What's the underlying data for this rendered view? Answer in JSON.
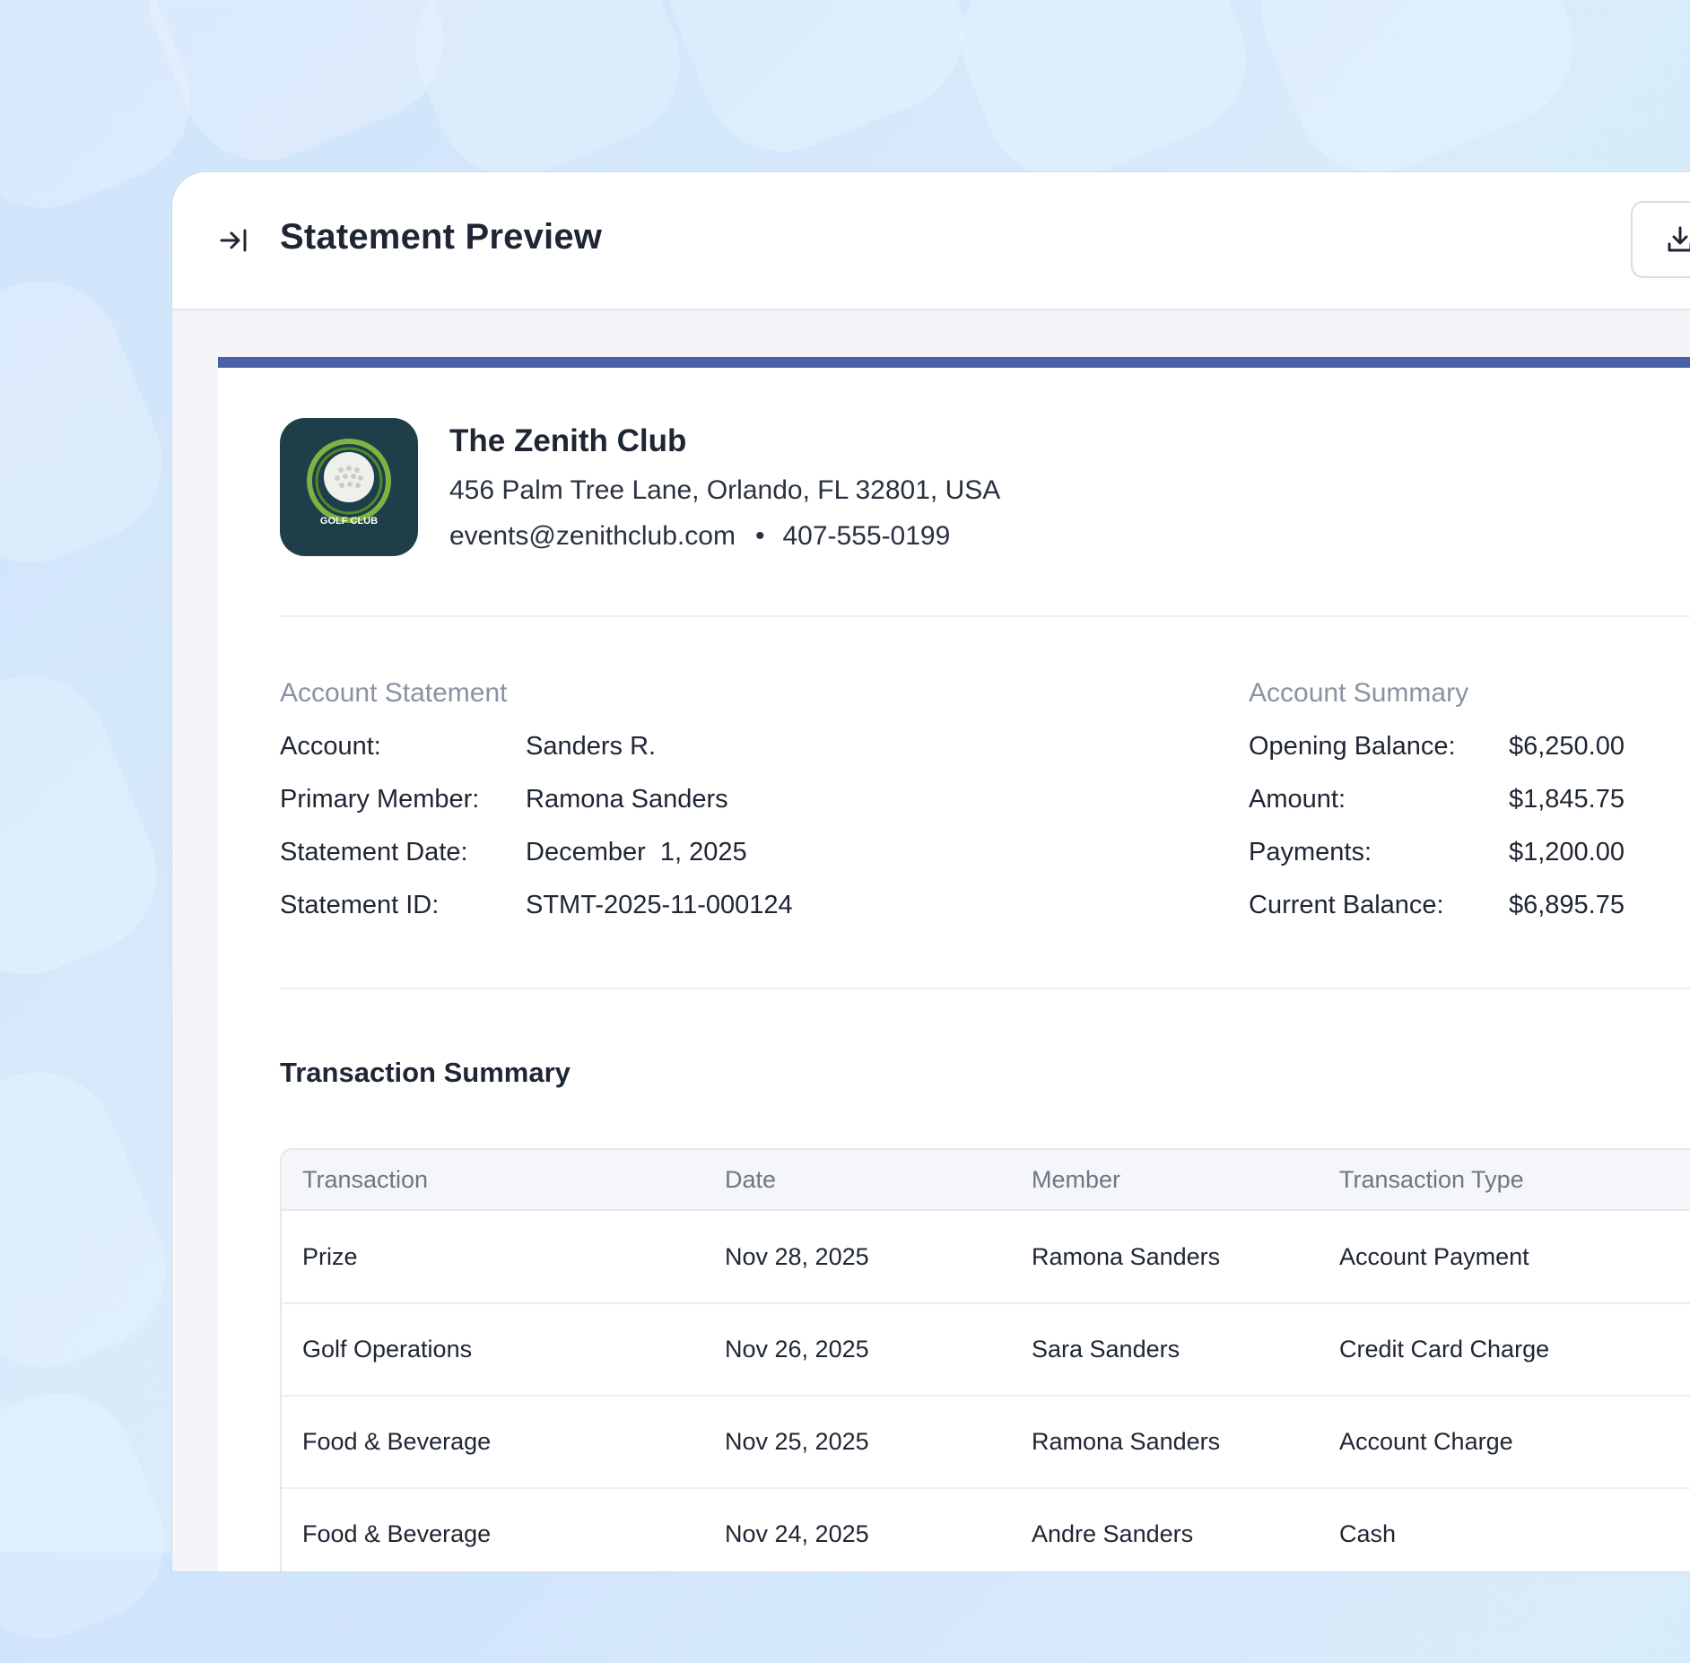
{
  "header": {
    "title": "Statement Preview",
    "collapse_icon": "collapse-panel-icon",
    "download_icon": "download-icon"
  },
  "club": {
    "name": "The Zenith Club",
    "address": "456 Palm Tree Lane, Orlando, FL 32801, USA",
    "email": "events@zenithclub.com",
    "separator": "•",
    "phone": "407-555-0199",
    "logo_text": "GOLF CLUB"
  },
  "account_statement": {
    "heading": "Account Statement",
    "rows": [
      {
        "label": "Account:",
        "value": "Sanders R."
      },
      {
        "label": "Primary Member:",
        "value": "Ramona Sanders"
      },
      {
        "label": "Statement Date:",
        "value": "December  1, 2025"
      },
      {
        "label": "Statement ID:",
        "value": "STMT-2025-11-000124"
      }
    ]
  },
  "account_summary": {
    "heading": "Account Summary",
    "rows": [
      {
        "label": "Opening Balance:",
        "value": "$6,250.00"
      },
      {
        "label": "Amount:",
        "value": "$1,845.75"
      },
      {
        "label": "Payments:",
        "value": "$1,200.00"
      },
      {
        "label": "Current Balance:",
        "value": "$6,895.75"
      }
    ]
  },
  "transactions": {
    "title": "Transaction Summary",
    "columns": [
      "Transaction",
      "Date",
      "Member",
      "Transaction Type"
    ],
    "rows": [
      {
        "transaction": "Prize",
        "date": "Nov 28, 2025",
        "member": "Ramona Sanders",
        "type": "Account Payment"
      },
      {
        "transaction": "Golf Operations",
        "date": "Nov 26, 2025",
        "member": "Sara Sanders",
        "type": "Credit Card Charge"
      },
      {
        "transaction": "Food & Beverage",
        "date": "Nov 25, 2025",
        "member": "Ramona Sanders",
        "type": "Account Charge"
      },
      {
        "transaction": "Food & Beverage",
        "date": "Nov 24, 2025",
        "member": "Andre Sanders",
        "type": "Cash"
      }
    ]
  },
  "colors": {
    "accent": "#4a5fa8",
    "logo_bg": "#1e3f4a",
    "logo_ring": "#7cb342"
  }
}
